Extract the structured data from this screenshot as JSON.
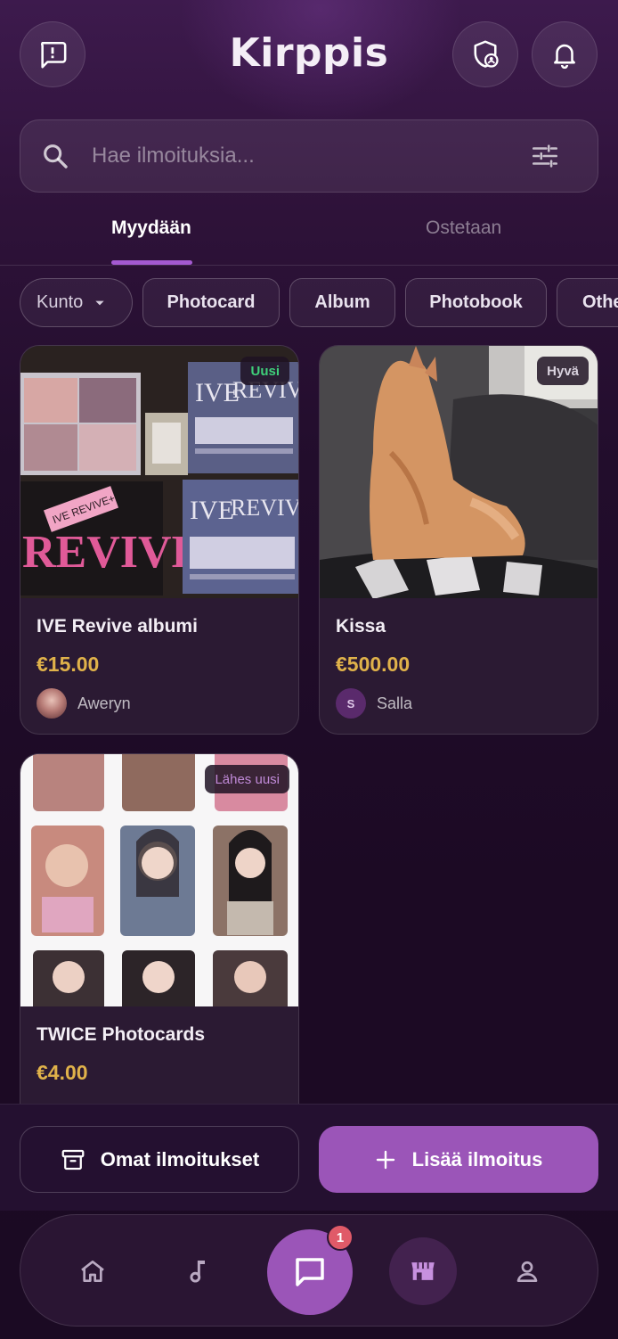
{
  "app": {
    "title": "Kirppis"
  },
  "header": {
    "report_icon": "feedback-icon",
    "safety_icon": "shield-user-icon",
    "notifications_icon": "bell-icon"
  },
  "search": {
    "placeholder": "Hae ilmoituksia..."
  },
  "tabs": [
    {
      "label": "Myydään",
      "active": true
    },
    {
      "label": "Ostetaan",
      "active": false
    }
  ],
  "filters": {
    "condition": "Kunto",
    "categories": [
      "Photocard",
      "Album",
      "Photobook",
      "Other"
    ]
  },
  "listings": [
    {
      "title": "IVE Revive albumi",
      "price": "€15.00",
      "condition": "Uusi",
      "seller": "Aweryn"
    },
    {
      "title": "Kissa",
      "price": "€500.00",
      "condition": "Hyvä",
      "seller": "Salla",
      "seller_initial": "S"
    },
    {
      "title": "TWICE Photocards",
      "price": "€4.00",
      "condition": "Lähes uusi"
    }
  ],
  "actions": {
    "my_listings": "Omat ilmoitukset",
    "add_listing": "Lisää ilmoitus"
  },
  "bottom_nav": {
    "items": [
      "home-icon",
      "music-icon",
      "chat-icon",
      "store-icon",
      "profile-icon"
    ],
    "chat_badge": "1"
  },
  "colors": {
    "accent": "#9b55b8",
    "price": "#e0b24a",
    "badge_new": "#3fd07a",
    "badge_good": "#d9d2de",
    "badge_almost_new": "#c08ad8",
    "notification": "#e05a68"
  }
}
